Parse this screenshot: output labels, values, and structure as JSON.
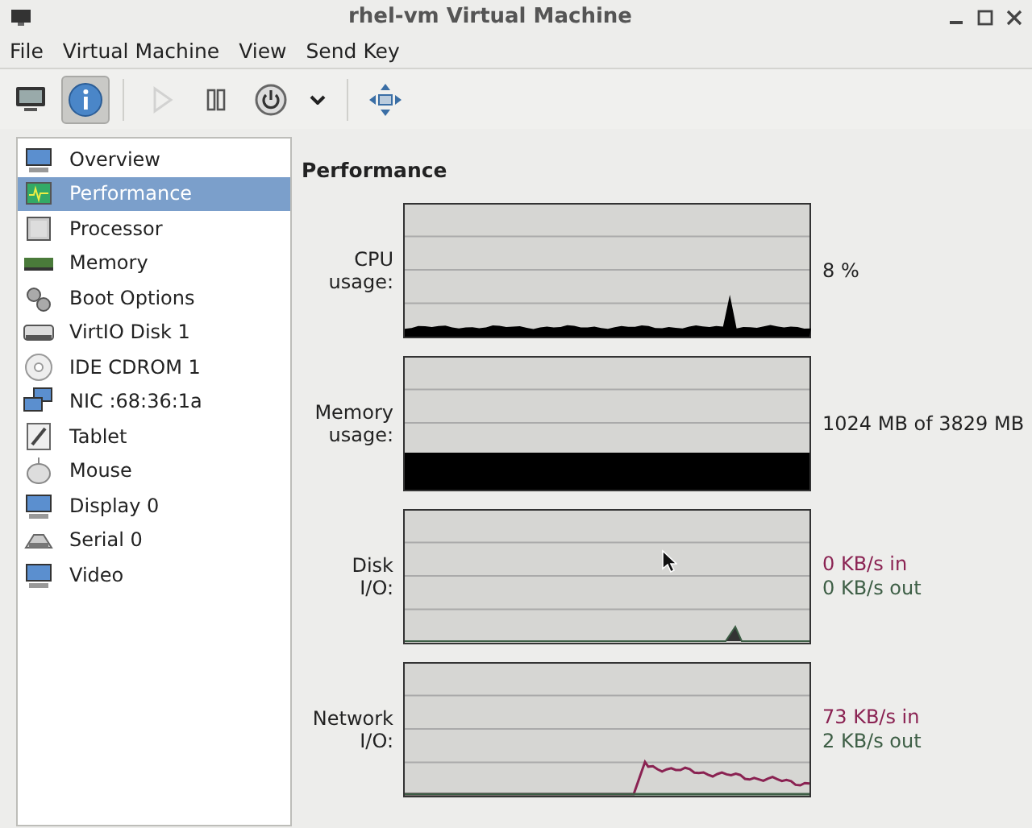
{
  "window": {
    "title": "rhel-vm Virtual Machine"
  },
  "menu": [
    "File",
    "Virtual Machine",
    "View",
    "Send Key"
  ],
  "toolbar": [
    {
      "kind": "console",
      "selected": false,
      "disabled": false
    },
    {
      "kind": "details",
      "selected": true,
      "disabled": false
    },
    {
      "kind": "run",
      "selected": false,
      "disabled": true
    },
    {
      "kind": "pause",
      "selected": false,
      "disabled": false
    },
    {
      "kind": "power",
      "selected": false,
      "disabled": false
    },
    {
      "kind": "dropdown",
      "selected": false,
      "disabled": false
    },
    {
      "kind": "fullscreen",
      "selected": false,
      "disabled": false
    }
  ],
  "sidebar": {
    "items": [
      {
        "label": "Overview",
        "selected": false
      },
      {
        "label": "Performance",
        "selected": true
      },
      {
        "label": "Processor",
        "selected": false
      },
      {
        "label": "Memory",
        "selected": false
      },
      {
        "label": "Boot Options",
        "selected": false
      },
      {
        "label": "VirtIO Disk 1",
        "selected": false
      },
      {
        "label": "IDE CDROM 1",
        "selected": false
      },
      {
        "label": "NIC :68:36:1a",
        "selected": false
      },
      {
        "label": "Tablet",
        "selected": false
      },
      {
        "label": "Mouse",
        "selected": false
      },
      {
        "label": "Display 0",
        "selected": false
      },
      {
        "label": "Serial 0",
        "selected": false
      },
      {
        "label": "Video",
        "selected": false
      }
    ]
  },
  "panel": {
    "heading": "Performance",
    "graphs": [
      {
        "kind": "cpu",
        "label": [
          "CPU",
          "usage:"
        ],
        "readings": [
          {
            "text": "8 %",
            "color": "#222222"
          }
        ]
      },
      {
        "kind": "memory",
        "label": [
          "Memory",
          "usage:"
        ],
        "readings": [
          {
            "text": "1024 MB of 3829 MB",
            "color": "#222222"
          }
        ]
      },
      {
        "kind": "disk",
        "label": [
          "Disk",
          "I/O:"
        ],
        "readings": [
          {
            "text": "0 KB/s in",
            "color": "#8a2252"
          },
          {
            "text": "0 KB/s out",
            "color": "#3d5e45"
          }
        ]
      },
      {
        "kind": "network",
        "label": [
          "Network",
          "I/O:"
        ],
        "readings": [
          {
            "text": "73 KB/s in",
            "color": "#8a2252"
          },
          {
            "text": "2 KB/s out",
            "color": "#3d5e45"
          }
        ]
      }
    ]
  }
}
